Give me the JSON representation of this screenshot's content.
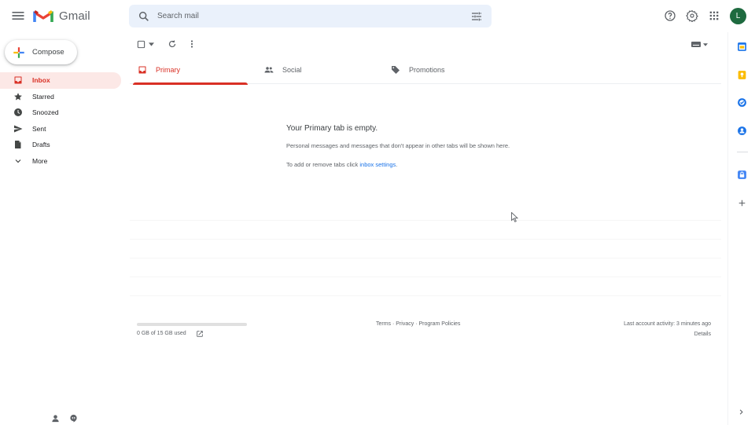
{
  "header": {
    "app_name": "Gmail",
    "search_placeholder": "Search mail",
    "avatar_letter": "L",
    "avatar_color": "#1e6a3f",
    "icons": [
      "menu-icon",
      "search-icon",
      "search-options-icon",
      "help-icon",
      "settings-icon",
      "apps-icon"
    ]
  },
  "compose": {
    "label": "Compose"
  },
  "nav": {
    "items": [
      {
        "label": "Inbox",
        "icon": "inbox-icon",
        "active": true
      },
      {
        "label": "Starred",
        "icon": "star-icon"
      },
      {
        "label": "Snoozed",
        "icon": "clock-icon"
      },
      {
        "label": "Sent",
        "icon": "send-icon"
      },
      {
        "label": "Drafts",
        "icon": "draft-icon"
      },
      {
        "label": "More",
        "icon": "chevron-down-icon"
      }
    ]
  },
  "tabs": [
    {
      "label": "Primary",
      "icon": "inbox-icon",
      "active": true
    },
    {
      "label": "Social",
      "icon": "people-icon"
    },
    {
      "label": "Promotions",
      "icon": "tag-icon"
    }
  ],
  "empty_state": {
    "title": "Your Primary tab is empty.",
    "description": "Personal messages and messages that don't appear in other tabs will be shown here.",
    "hint_prefix": "To add or remove tabs click ",
    "hint_link": "inbox settings",
    "hint_suffix": "."
  },
  "footer": {
    "storage": "0 GB of 15 GB used",
    "storage_fraction": 0.0,
    "links": [
      "Terms",
      "Privacy",
      "Program Policies"
    ],
    "link_separator": " · ",
    "last_activity": "Last account activity: 3 minutes ago",
    "details": "Details"
  },
  "colors": {
    "accent_red": "#d93025",
    "active_bg": "#fce8e6",
    "link_blue": "#1a73e8",
    "search_bg": "#eaf1fb"
  }
}
